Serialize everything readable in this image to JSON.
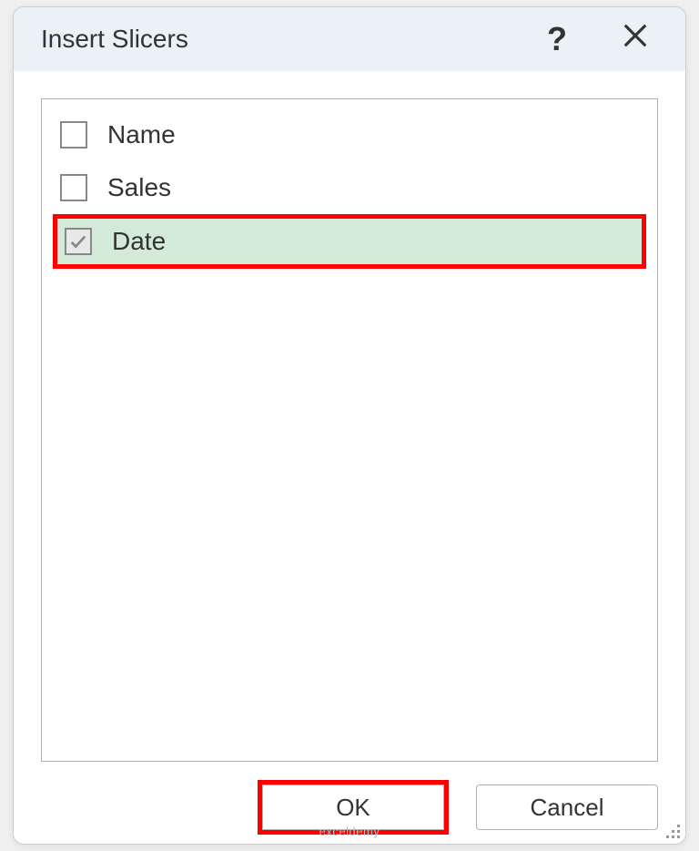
{
  "dialog": {
    "title": "Insert Slicers",
    "help_symbol": "?",
    "fields": [
      {
        "label": "Name",
        "checked": false,
        "highlighted": false
      },
      {
        "label": "Sales",
        "checked": false,
        "highlighted": false
      },
      {
        "label": "Date",
        "checked": true,
        "highlighted": true
      }
    ],
    "buttons": {
      "ok": "OK",
      "cancel": "Cancel"
    }
  },
  "watermark": "exceldemy"
}
